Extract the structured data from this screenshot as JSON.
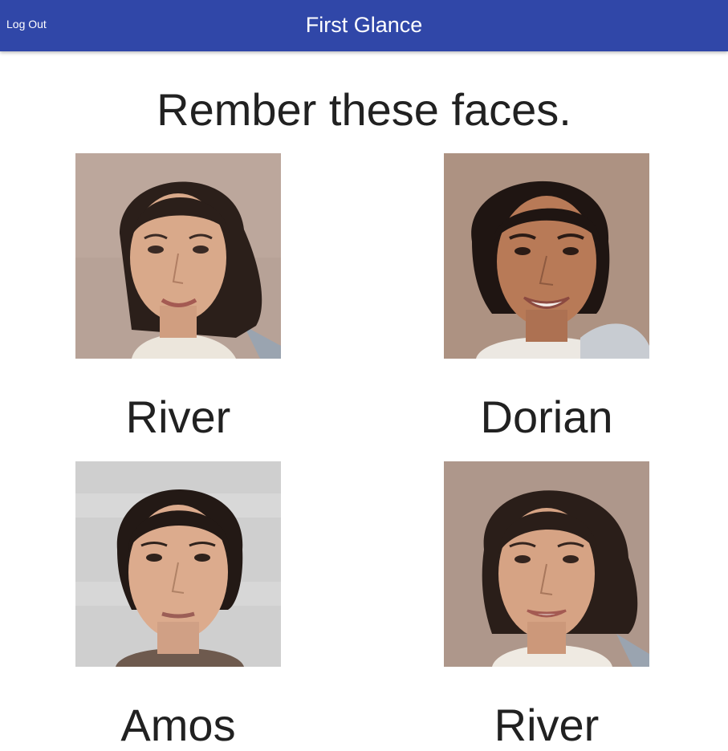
{
  "header": {
    "logout_label": "Log Out",
    "title": "First Glance",
    "color": "#3047a8"
  },
  "main": {
    "heading": "Rember these faces.",
    "faces": [
      {
        "name": "River"
      },
      {
        "name": "Dorian"
      },
      {
        "name": "Amos"
      },
      {
        "name": "River"
      }
    ]
  }
}
